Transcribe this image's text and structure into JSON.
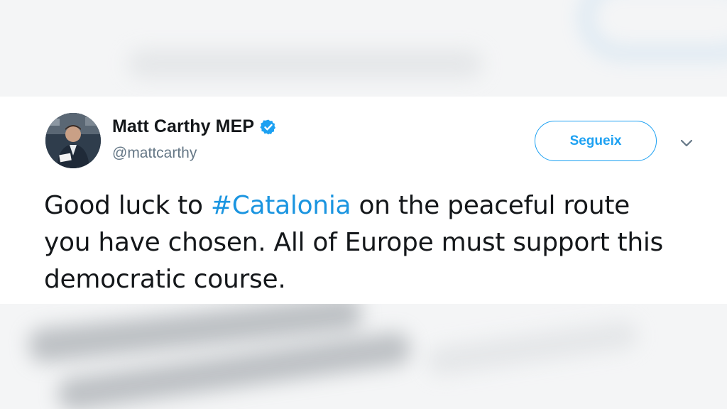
{
  "tweet": {
    "author_name": "Matt Carthy MEP",
    "handle": "@mattcarthy",
    "follow_label": "Segueix",
    "text_before": "Good luck to ",
    "hashtag": "#Catalonia",
    "text_after": " on the peaceful route you have chosen. All of Europe must support this democratic course.",
    "verified": true
  },
  "icons": {
    "verified": "verified-badge-icon",
    "more": "chevron-down-icon"
  },
  "colors": {
    "accent": "#1da1f2",
    "hashtag": "#1b95e0",
    "text": "#14171a",
    "muted": "#657786"
  }
}
